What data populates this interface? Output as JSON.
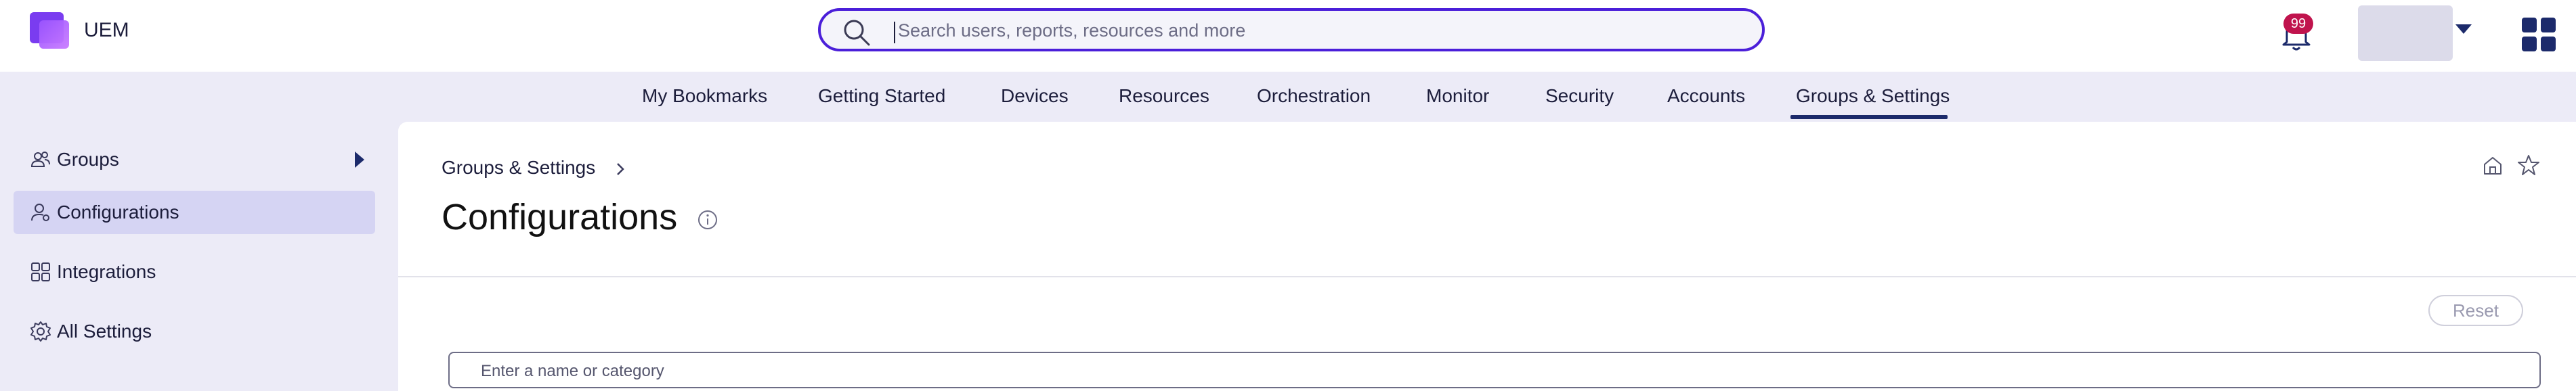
{
  "app": {
    "name": "UEM"
  },
  "search": {
    "placeholder": "Search users, reports, resources and more"
  },
  "notifications": {
    "count": "99"
  },
  "nav": {
    "items": [
      {
        "label": "My Bookmarks"
      },
      {
        "label": "Getting Started"
      },
      {
        "label": "Devices"
      },
      {
        "label": "Resources"
      },
      {
        "label": "Orchestration"
      },
      {
        "label": "Monitor"
      },
      {
        "label": "Security"
      },
      {
        "label": "Accounts"
      },
      {
        "label": "Groups & Settings"
      }
    ],
    "active": "Groups & Settings"
  },
  "sidebar": {
    "items": [
      {
        "label": "Groups",
        "icon": "groups-icon"
      },
      {
        "label": "Configurations",
        "icon": "user-settings-icon"
      },
      {
        "label": "Integrations",
        "icon": "integrations-icon"
      },
      {
        "label": "All Settings",
        "icon": "gear-icon"
      }
    ],
    "active": "Configurations"
  },
  "main": {
    "breadcrumb": "Groups & Settings",
    "title": "Configurations",
    "reset_label": "Reset",
    "filter_placeholder": "Enter a name or category"
  },
  "colors": {
    "accent": "#4b1fd9",
    "brand": "#7a3cf0",
    "nav_active": "#1c2a6b",
    "badge": "#c0134d",
    "sidebar_active": "#d5d4f3"
  }
}
